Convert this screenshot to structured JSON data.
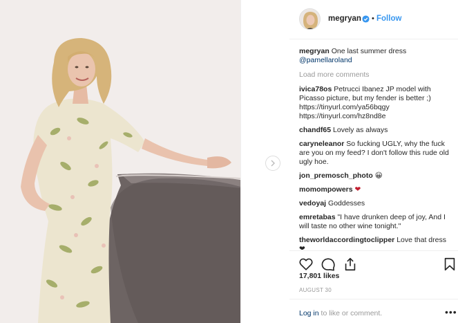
{
  "post": {
    "author": {
      "username": "megryan",
      "verified": true,
      "follow_label": "Follow",
      "separator": "•"
    },
    "caption": {
      "username": "megryan",
      "text": "One last summer dress",
      "tag": "@pamellaroland"
    },
    "load_more_label": "Load more comments",
    "comments": [
      {
        "username": "ivica78os",
        "text": "Petrucci Ibanez JP model with Picasso picture, but my fender is better ;) https://tinyurl.com/ya56bqgy https://tinyurl.com/hz8nd8e"
      },
      {
        "username": "chandf65",
        "text": "Lovely as always"
      },
      {
        "username": "caryneleanor",
        "text": "So fucking UGLY, why the fuck are you on my feed? I don't follow this rude old ugly hoe."
      },
      {
        "username": "jon_premosch_photo",
        "text": "😀"
      },
      {
        "username": "momompowers",
        "text": "❤"
      },
      {
        "username": "vedoyaj",
        "text": "Goddesses"
      },
      {
        "username": "emretabas",
        "text": "\"I have drunken deep of joy, And I will taste no other wine tonight.\""
      },
      {
        "username": "theworldaccordingtoclipper",
        "text": "Love that dress ❤"
      }
    ],
    "likes_label": "17,801 likes",
    "date_label": "AUGUST 30",
    "login_link": "Log in",
    "login_suffix": " to like or comment.",
    "more_label": "•••"
  },
  "icons": {
    "like": "heart-outline-icon",
    "comment": "comment-bubble-icon",
    "share": "share-icon",
    "save": "bookmark-icon",
    "next": "chevron-right-icon",
    "verified": "verified-badge-icon"
  },
  "colors": {
    "link_blue": "#3897f0",
    "verified_blue": "#3897f0",
    "muted": "#999999",
    "text": "#262626"
  }
}
